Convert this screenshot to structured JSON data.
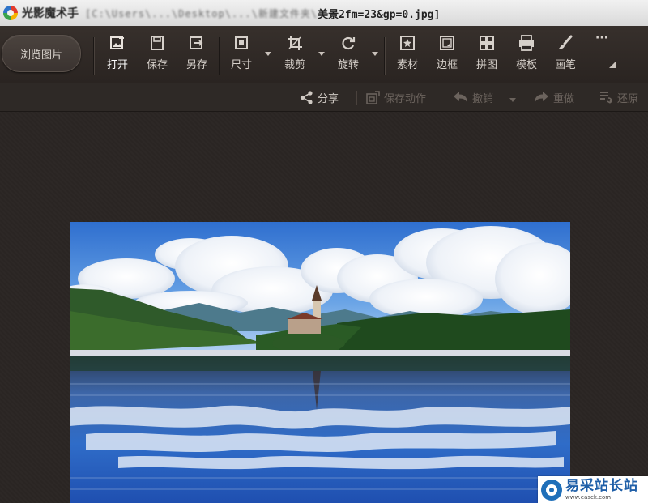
{
  "titlebar": {
    "app_name": "光影魔术手",
    "path_blurred": "[C:\\Users\\...\\Desktop\\...\\新建文件夹\\",
    "filename": "美景2fm=23&gp=0.jpg]"
  },
  "toolbar": {
    "browse_label": "浏览图片",
    "tools": [
      {
        "label": "打开",
        "icon": "open-image-icon"
      },
      {
        "label": "保存",
        "icon": "save-icon"
      },
      {
        "label": "另存",
        "icon": "save-as-icon"
      },
      {
        "label": "尺寸",
        "icon": "resize-icon"
      },
      {
        "label": "裁剪",
        "icon": "crop-icon"
      },
      {
        "label": "旋转",
        "icon": "rotate-icon"
      },
      {
        "label": "素材",
        "icon": "material-icon"
      },
      {
        "label": "边框",
        "icon": "frame-icon"
      },
      {
        "label": "拼图",
        "icon": "collage-icon"
      },
      {
        "label": "模板",
        "icon": "template-icon"
      },
      {
        "label": "画笔",
        "icon": "brush-icon"
      },
      {
        "label": "···",
        "icon": "more-icon"
      }
    ]
  },
  "subbar": {
    "share": "分享",
    "save_action": "保存动作",
    "undo": "撤销",
    "redo": "重做",
    "restore": "还原"
  },
  "colors": {
    "toolbar_bg": "#2a2421",
    "text_active": "#d6d0ca",
    "text_disabled": "#6b635d"
  },
  "watermark": {
    "name": "易采站长站",
    "url": "www.easck.com"
  }
}
